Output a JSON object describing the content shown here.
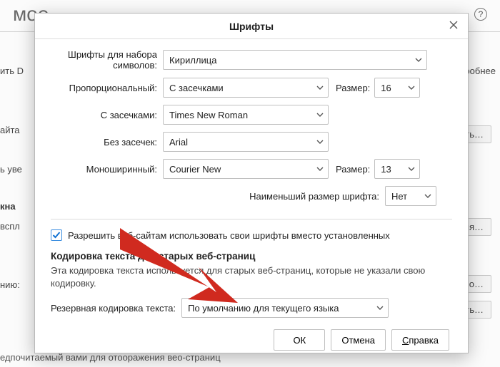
{
  "background": {
    "title_fragment": "мое",
    "dotrack_fragment": "ить D",
    "learn_more_fragment": "одробнее",
    "site_fragment": "айта",
    "trust_fragment": "ь уве",
    "window_head_fragment": "кна",
    "popup_fragment": "вспл",
    "prompts_fragment": "нию:",
    "bottom_fragment": "едпочитаемый вами для отооражения вео-страниц",
    "btn_choose": "ыбрать…",
    "btn_except": "чения…",
    "btn_extra": "тельно…",
    "btn_choose2": "ыбрать…"
  },
  "dialog": {
    "title": "Шрифты",
    "rows": {
      "charset_label": "Шрифты для набора символов:",
      "charset_value": "Кириллица",
      "prop_label": "Пропорциональный:",
      "prop_value": "С засечками",
      "size_label_1": "Размер:",
      "size_value_1": "16",
      "serif_label": "С засечками:",
      "serif_value": "Times New Roman",
      "sans_label": "Без засечек:",
      "sans_value": "Arial",
      "mono_label": "Моноширинный:",
      "mono_value": "Courier New",
      "size_label_2": "Размер:",
      "size_value_2": "13",
      "min_label": "Наименьший размер шрифта:",
      "min_value": "Нет"
    },
    "checkbox_label": "Разрешить веб-сайтам использовать свои шрифты вместо установленных",
    "encoding": {
      "head": "Кодировка текста для старых веб-страниц",
      "desc": "Эта кодировка текста используется для старых веб-страниц, которые не указали свою кодировку.",
      "label": "Резервная кодировка текста:",
      "value": "По умолчанию для текущего языка"
    },
    "buttons": {
      "ok": "ОК",
      "cancel": "Отмена",
      "help_pre": "С",
      "help_rest": "правка"
    }
  }
}
